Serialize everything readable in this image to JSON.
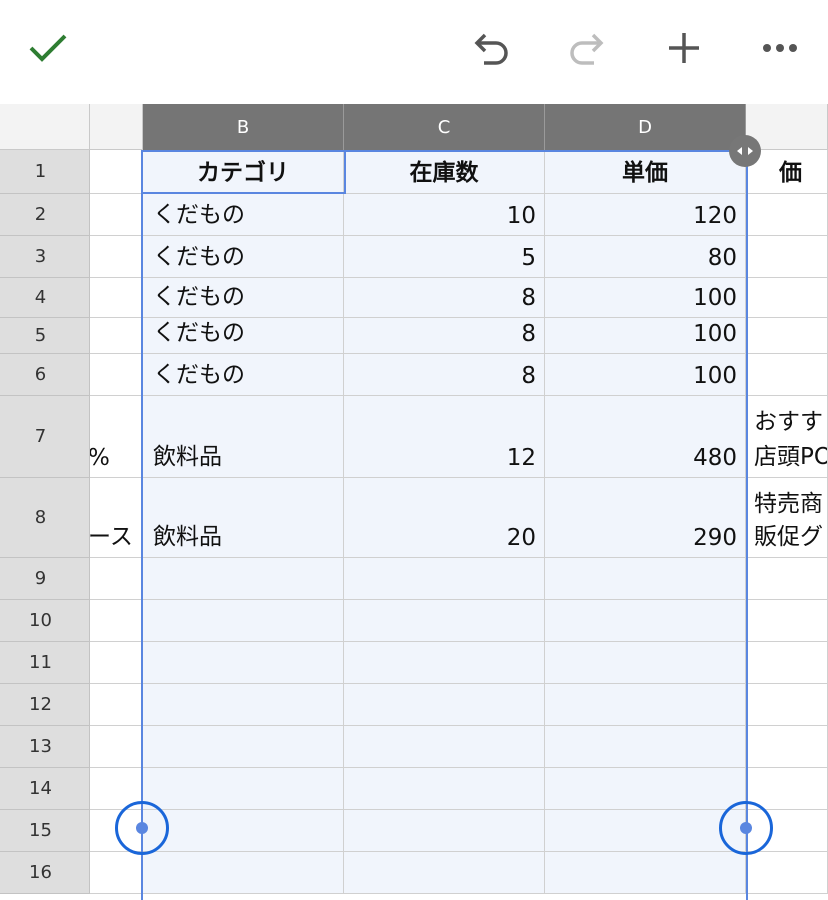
{
  "toolbar": {
    "confirm_icon": "checkmark-icon",
    "undo_icon": "undo-icon",
    "redo_icon": "redo-icon",
    "add_icon": "plus-icon",
    "more_icon": "more-horizontal-icon",
    "accent": "#2e7d32"
  },
  "columns": [
    "B",
    "C",
    "D"
  ],
  "rows": [
    "1",
    "2",
    "3",
    "4",
    "5",
    "6",
    "7",
    "8",
    "9",
    "10",
    "11",
    "12",
    "13",
    "14",
    "15",
    "16"
  ],
  "header_row": {
    "b": "カテゴリ",
    "c": "在庫数",
    "d": "単価",
    "e": "価"
  },
  "data_rows": [
    {
      "a": "",
      "b": "くだもの",
      "c": "10",
      "d": "120",
      "e_top": "",
      "e": ""
    },
    {
      "a": "",
      "b": "くだもの",
      "c": "5",
      "d": "80",
      "e_top": "",
      "e": ""
    },
    {
      "a": "",
      "b": "くだもの",
      "c": "8",
      "d": "100",
      "e_top": "",
      "e": ""
    },
    {
      "a": "",
      "b": "くだもの",
      "c": "8",
      "d": "100",
      "e_top": "",
      "e": ""
    },
    {
      "a": "",
      "b": "くだもの",
      "c": "8",
      "d": "100",
      "e_top": "",
      "e": ""
    },
    {
      "a": "%",
      "b": "飲料品",
      "c": "12",
      "d": "480",
      "e_top": "おすす",
      "e": "店頭PO"
    },
    {
      "a": "ース",
      "b": "飲料品",
      "c": "20",
      "d": "290",
      "e_top": "特売商",
      "e": "販促グ"
    }
  ],
  "colors": {
    "selection": "#5a86e0",
    "handle_ring": "#1a66d9",
    "header_selected": "#757575"
  }
}
